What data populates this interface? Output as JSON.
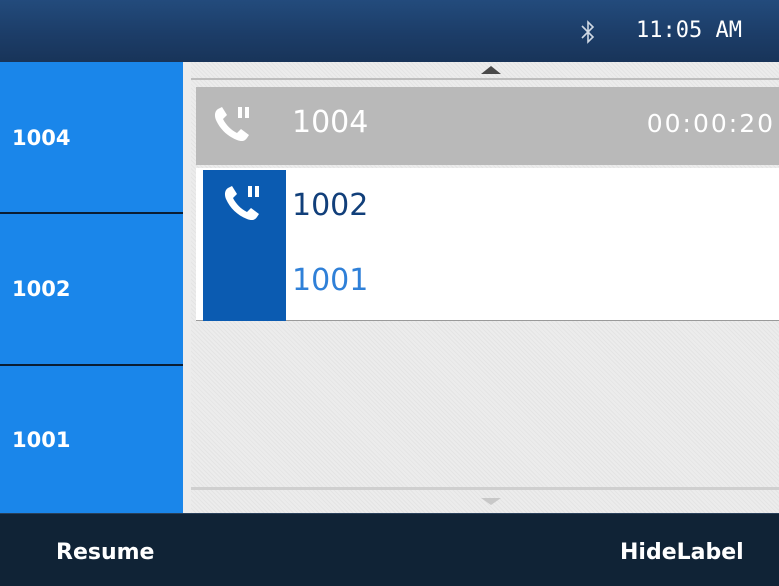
{
  "status_bar": {
    "time": "11:05 AM",
    "icons": [
      "bluetooth-icon"
    ]
  },
  "line_keys": [
    {
      "label": "1004"
    },
    {
      "label": "1002"
    },
    {
      "label": "1001"
    }
  ],
  "calls": {
    "held": {
      "number": "1004",
      "duration": "00:00:20",
      "icon": "phone-icon"
    },
    "active_conference": {
      "icon": "phone-icon",
      "parties": [
        "1002",
        "1001"
      ]
    }
  },
  "softkeys": {
    "left": "Resume",
    "right": "HideLabel"
  },
  "colors": {
    "status_bar": "#1c3d68",
    "line_key": "#1a86ea",
    "held_row": "#b9b9b9",
    "conference_icon_block": "#0b5bb1",
    "primary_party_text": "#113f7a",
    "secondary_party_text": "#2f80d8",
    "softkey_bar": "#102336"
  }
}
